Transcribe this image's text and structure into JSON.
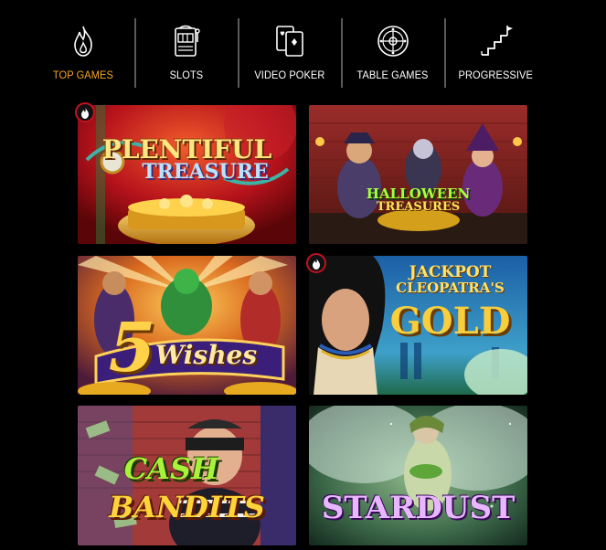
{
  "nav": {
    "tabs": [
      {
        "label": "TOP GAMES",
        "icon": "flame-icon",
        "active": true
      },
      {
        "label": "SLOTS",
        "icon": "slot-machine-icon",
        "active": false
      },
      {
        "label": "VIDEO POKER",
        "icon": "playing-cards-icon",
        "active": false
      },
      {
        "label": "TABLE GAMES",
        "icon": "roulette-wheel-icon",
        "active": false
      },
      {
        "label": "PROGRESSIVE",
        "icon": "stairs-flag-icon",
        "active": false
      }
    ]
  },
  "games": [
    {
      "line1": "PLENTIFUL",
      "line2": "TREASURE",
      "hot": true
    },
    {
      "line1": "HALLOWEEN",
      "line2": "TREASURES",
      "hot": false
    },
    {
      "line1": "5",
      "line2": "Wishes",
      "hot": false
    },
    {
      "line1": "JACKPOT",
      "line2": "CLEOPATRA'S",
      "line3": "GOLD",
      "hot": true
    },
    {
      "line1": "CASH",
      "line2": "BANDITS",
      "hot": false
    },
    {
      "line1": "STARDUST",
      "hot": false
    }
  ],
  "colors": {
    "accent": "#f5a623",
    "hot_ring": "#c1121f"
  }
}
